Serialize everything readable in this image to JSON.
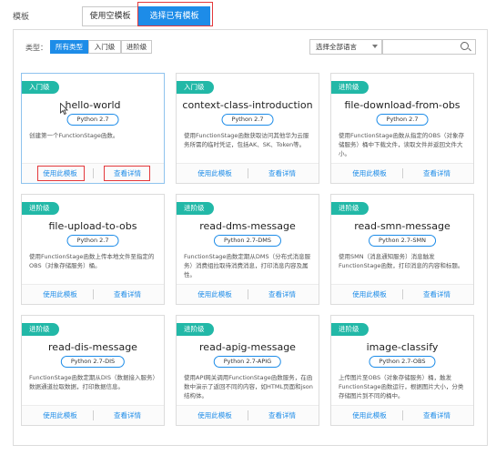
{
  "header": {
    "label": "模板",
    "tab_blank": "使用空模板",
    "tab_existing": "选择已有模板"
  },
  "filters": {
    "label": "类型：",
    "all": "所有类型",
    "entry": "入门级",
    "advanced": "进阶级"
  },
  "language_select": {
    "value": "选择全部语言"
  },
  "search": {
    "placeholder": ""
  },
  "colors": {
    "accent": "#1d8ce8",
    "badge": "#22b8a7",
    "highlight": "#e4393c"
  },
  "cards": [
    {
      "badge": "入门级",
      "title": "hello-world",
      "runtime": "Python 2.7",
      "desc": "创建第一个FunctionStage函数。",
      "use": "使用此模板",
      "view": "查看详情"
    },
    {
      "badge": "入门级",
      "title": "context-class-introduction",
      "runtime": "Python 2.7",
      "desc": "使用FunctionStage函数获取访问其他华为云服务所需的临时凭证，包括AK、SK、Token等。",
      "use": "使用此模板",
      "view": "查看详情"
    },
    {
      "badge": "进阶级",
      "title": "file-download-from-obs",
      "runtime": "Python 2.7",
      "desc": "使用FunctionStage函数从指定的OBS（对象存储服务）桶中下载文件，读取文件并返回文件大小。",
      "use": "使用此模板",
      "view": "查看详情"
    },
    {
      "badge": "进阶级",
      "title": "file-upload-to-obs",
      "runtime": "Python 2.7",
      "desc": "使用FunctionStage函数上传本地文件至指定的OBS（对象存储服务）桶。",
      "use": "使用此模板",
      "view": "查看详情"
    },
    {
      "badge": "进阶级",
      "title": "read-dms-message",
      "runtime": "Python 2.7-DMS",
      "desc": "FunctionStage函数定期从DMS（分布式消息服务）消费组拉取待消费消息，打印消息内容及属性。",
      "use": "使用此模板",
      "view": "查看详情"
    },
    {
      "badge": "进阶级",
      "title": "read-smn-message",
      "runtime": "Python 2.7-SMN",
      "desc": "使用SMN（消息通知服务）消息触发FunctionStage函数，打印消息的内容和标题。",
      "use": "使用此模板",
      "view": "查看详情"
    },
    {
      "badge": "进阶级",
      "title": "read-dis-message",
      "runtime": "Python 2.7-DIS",
      "desc": "FunctionStage函数定期从DIS（数据接入服务）数据通道拉取数据，打印数据信息。",
      "use": "使用此模板",
      "view": "查看详情"
    },
    {
      "badge": "进阶级",
      "title": "read-apig-message",
      "runtime": "Python 2.7-APIG",
      "desc": "使用API网关调用FunctionStage函数服务，在函数中演示了返回不同的内容，如HTML页面和json结构体。",
      "use": "使用此模板",
      "view": "查看详情"
    },
    {
      "badge": "进阶级",
      "title": "image-classify",
      "runtime": "Python 2.7-OBS",
      "desc": "上传图片至OBS（对象存储服务）桶，触发FunctionStage函数运行，根据图片大小，分类存储图片到不同的桶中。",
      "use": "使用此模板",
      "view": "查看详情"
    }
  ]
}
